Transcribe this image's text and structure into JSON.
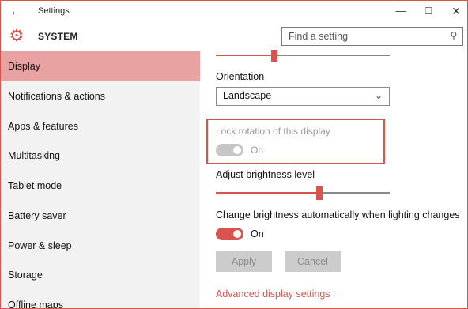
{
  "window": {
    "title": "Settings",
    "back_glyph": "←",
    "minimize_glyph": "—",
    "maximize_glyph": "☐",
    "close_glyph": "✕"
  },
  "header": {
    "section": "SYSTEM",
    "section_icon": "gear-icon",
    "search_placeholder": "Find a setting",
    "search_icon": "search-icon"
  },
  "sidebar": {
    "items": [
      {
        "label": "Display",
        "active": true
      },
      {
        "label": "Notifications & actions",
        "active": false
      },
      {
        "label": "Apps & features",
        "active": false
      },
      {
        "label": "Multitasking",
        "active": false
      },
      {
        "label": "Tablet mode",
        "active": false
      },
      {
        "label": "Battery saver",
        "active": false
      },
      {
        "label": "Power & sleep",
        "active": false
      },
      {
        "label": "Storage",
        "active": false
      },
      {
        "label": "Offline maps",
        "active": false
      }
    ]
  },
  "content": {
    "orientation_label": "Orientation",
    "orientation_value": "Landscape",
    "lock_rotation_label": "Lock rotation of this display",
    "lock_rotation_state": "On",
    "lock_rotation_enabled": false,
    "brightness_label": "Adjust brightness level",
    "brightness_level": 0.6,
    "auto_brightness_label": "Change brightness automatically when lighting changes",
    "auto_brightness_state": "On",
    "apply_label": "Apply",
    "cancel_label": "Cancel",
    "advanced_link": "Advanced display settings"
  },
  "colors": {
    "accent": "#d9534f",
    "active_nav_bg": "#e8a2a2",
    "sidebar_bg": "#f2f2f2",
    "disabled_text": "#999999"
  }
}
